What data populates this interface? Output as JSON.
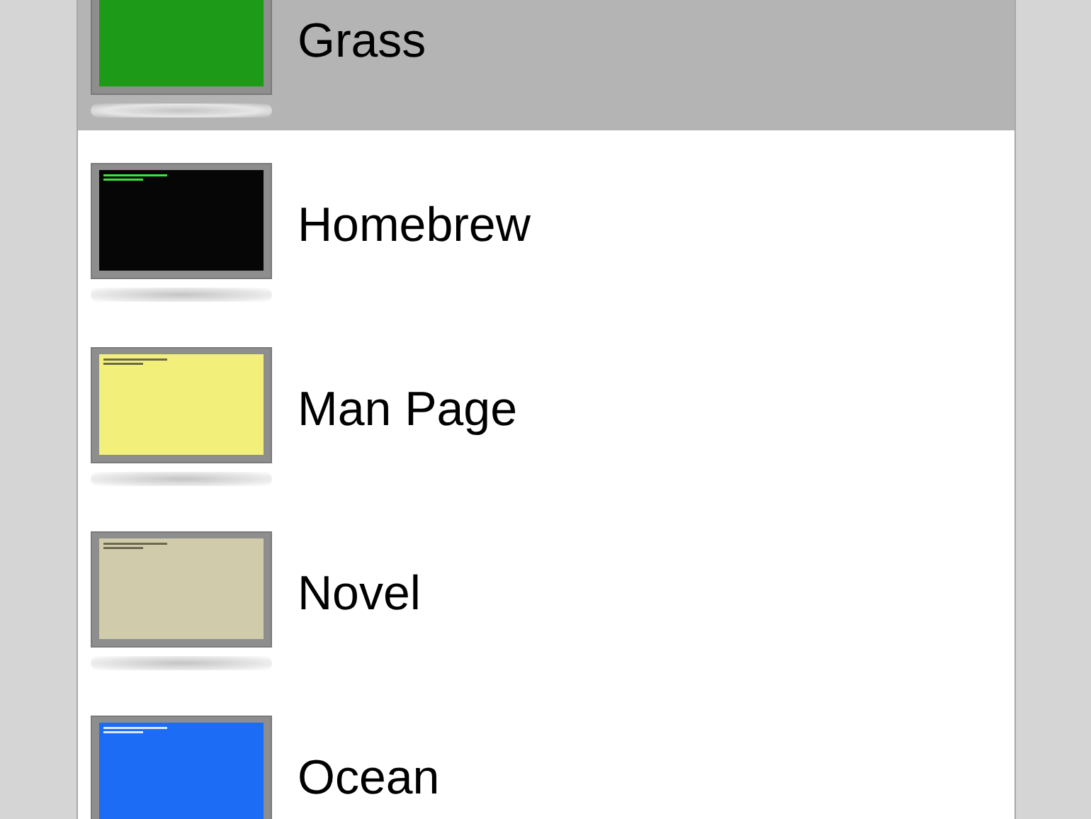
{
  "profiles": [
    {
      "name": "Grass",
      "color": "#1d9a18",
      "selected": true
    },
    {
      "name": "Homebrew",
      "color": "#060606",
      "selected": false
    },
    {
      "name": "Man Page",
      "color": "#f2f07a",
      "selected": false
    },
    {
      "name": "Novel",
      "color": "#d0cbab",
      "selected": false
    },
    {
      "name": "Ocean",
      "color": "#1c6cf6",
      "selected": false
    }
  ]
}
